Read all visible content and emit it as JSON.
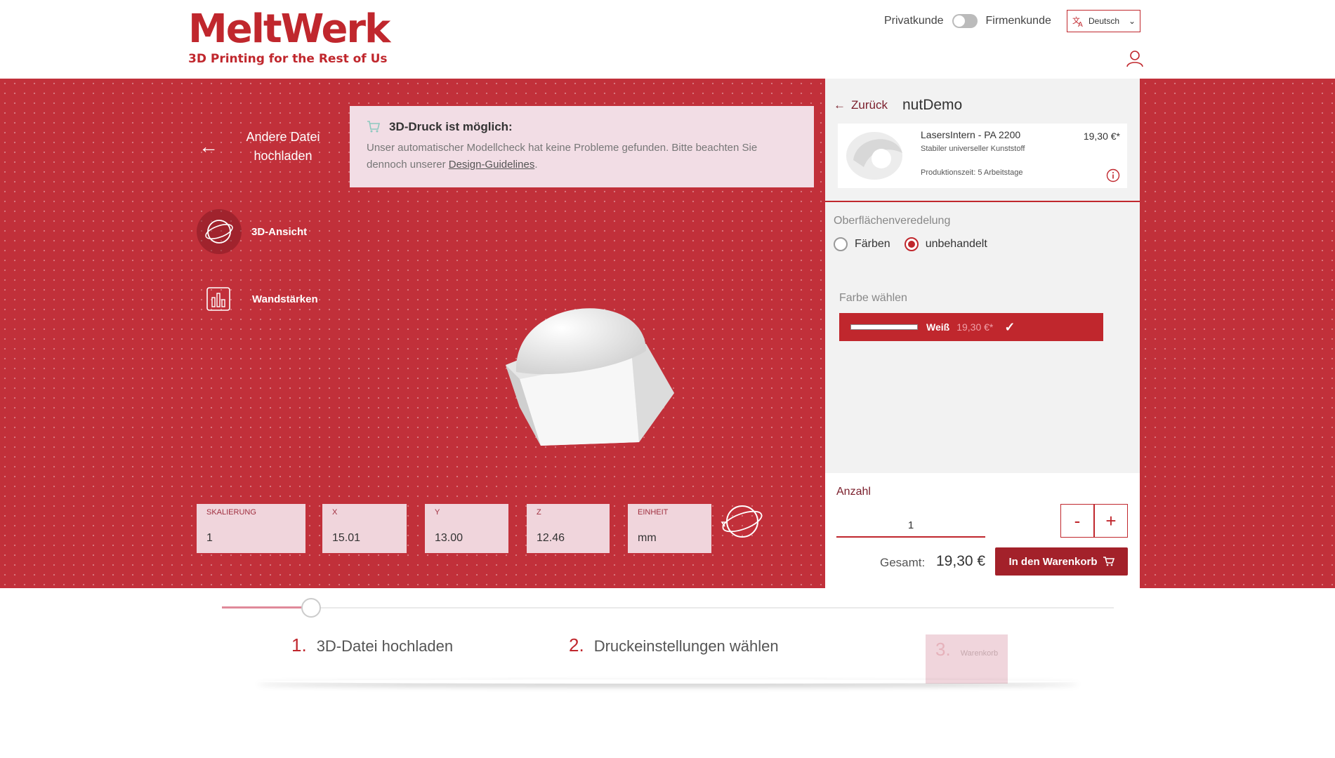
{
  "header": {
    "logo_main": "MeltWerk",
    "logo_tagline": "3D Printing for the Rest of Us",
    "customer_private": "Privatkunde",
    "customer_business": "Firmenkunde",
    "language": "Deutsch"
  },
  "viewer": {
    "upload_other": "Andere Datei hochladen",
    "nav_3d": "3D-Ansicht",
    "nav_wall": "Wandstärken",
    "info_title": "3D-Druck ist möglich:",
    "info_text": "Unser automatischer Modellcheck hat keine Probleme gefunden. Bitte beachten Sie dennoch unserer ",
    "info_link": "Design-Guidelines",
    "info_suffix": ".",
    "dims": {
      "scale_label": "SKALIERUNG",
      "scale_value": "1",
      "x_label": "X",
      "x_value": "15.01",
      "y_label": "Y",
      "y_value": "13.00",
      "z_label": "Z",
      "z_value": "12.46",
      "unit_label": "EINHEIT",
      "unit_value": "mm"
    }
  },
  "panel": {
    "back": "Zurück",
    "project_name": "nutDemo",
    "material": {
      "name": "LasersIntern - PA 2200",
      "description": "Stabiler universeller Kunststoff",
      "production_time": "Produktionszeit: 5 Arbeitstage",
      "price": "19,30 €*"
    },
    "finish_label": "Oberflächenveredelung",
    "finish_options": [
      "Färben",
      "unbehandelt"
    ],
    "finish_selected": "unbehandelt",
    "color_label": "Farbe wählen",
    "color_name": "Weiß",
    "color_price": "19,30 €*",
    "quantity_label": "Anzahl",
    "quantity": "1",
    "minus": "-",
    "plus": "+",
    "total_label": "Gesamt:",
    "total_value": "19,30 €",
    "cart_button": "In den Warenkorb"
  },
  "steps": [
    {
      "num": "1.",
      "label": "3D-Datei hochladen"
    },
    {
      "num": "2.",
      "label": "Druckeinstellungen wählen"
    },
    {
      "num": "3.",
      "label": "Warenkorb"
    }
  ],
  "progress_fraction": 0.1,
  "colors": {
    "brand": "#c0272d",
    "dark_brand": "#a3212a"
  }
}
